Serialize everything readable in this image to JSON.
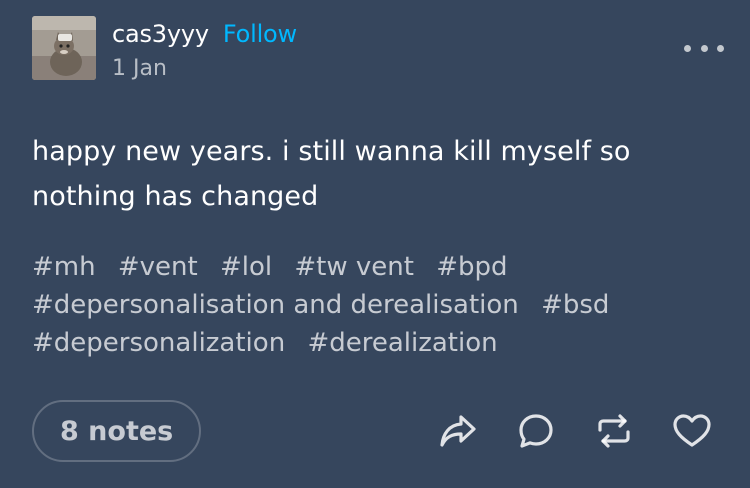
{
  "post": {
    "author": "cas3yyy",
    "follow_label": "Follow",
    "date": "1 Jan",
    "text_lines": [
      "happy new years. i still wanna kill myself so",
      "nothing has changed"
    ],
    "tags": [
      "#mh",
      "#vent",
      "#lol",
      "#tw vent",
      "#bpd",
      "#depersonalisation and derealisation",
      "#bsd",
      "#depersonalization",
      "#derealization"
    ]
  },
  "footer": {
    "notes_label": "8 notes",
    "actions": [
      "share-icon",
      "reply-icon",
      "reblog-icon",
      "like-icon"
    ]
  },
  "colors": {
    "background": "#36465d",
    "accent": "#00b8ff",
    "text": "#ffffff",
    "muted": "rgba(255,255,255,0.72)"
  }
}
